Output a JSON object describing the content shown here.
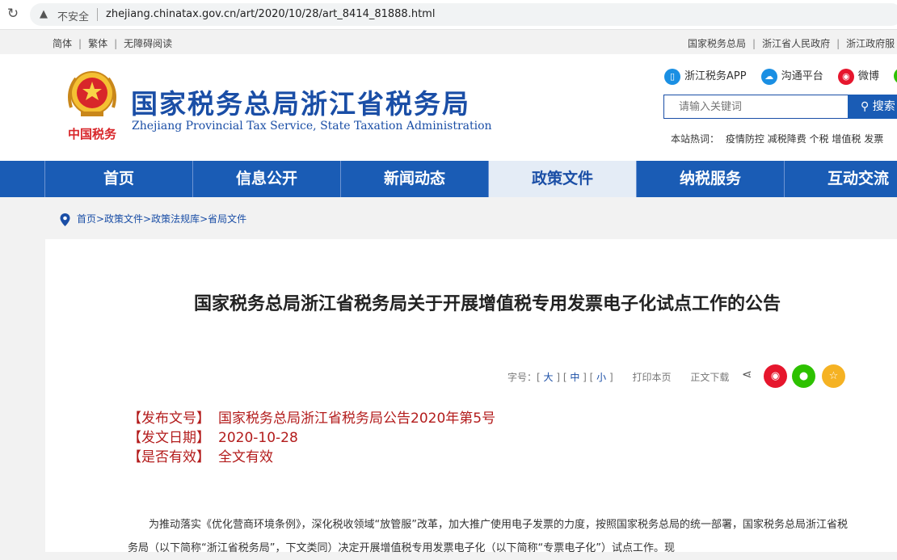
{
  "browser": {
    "security_label": "不安全",
    "url": "zhejiang.chinatax.gov.cn/art/2020/10/28/art_8414_81888.html"
  },
  "topbar": {
    "left": [
      "简体",
      "繁体",
      "无障碍阅读"
    ],
    "right": [
      "国家税务总局",
      "浙江省人民政府",
      "浙江政府服"
    ]
  },
  "header": {
    "logo_text": "中国税务",
    "title": "国家税务总局浙江省税务局",
    "title_en": "Zhejiang Provincial Tax Service, State Taxation Administration",
    "social": [
      {
        "label": "浙江税务APP",
        "icon": "phone-icon",
        "color": "#1a8fe3"
      },
      {
        "label": "沟通平台",
        "icon": "cloud-icon",
        "color": "#1a8fe3"
      },
      {
        "label": "微博",
        "icon": "weibo-icon",
        "color": "#e6162d"
      },
      {
        "label": "",
        "icon": "wechat-icon",
        "color": "#2dc100"
      }
    ],
    "search_placeholder": "请输入关键词",
    "search_button": "搜索",
    "hot_label": "本站热词：",
    "hot_words": [
      "疫情防控",
      "减税降费",
      "个税",
      "增值税",
      "发票"
    ]
  },
  "nav": {
    "items": [
      "首页",
      "信息公开",
      "新闻动态",
      "政策文件",
      "纳税服务",
      "互动交流"
    ],
    "active_index": 3
  },
  "breadcrumb": "首页>政策文件>政策法规库>省局文件",
  "article": {
    "title": "国家税务总局浙江省税务局关于开展增值税专用发票电子化试点工作的公告",
    "font_size_label": "字号：",
    "font_sizes": [
      "大",
      "中",
      "小"
    ],
    "print_label": "打印本页",
    "download_label": "正文下载",
    "share_buttons": [
      {
        "icon": "weibo-icon",
        "color": "#e6162d"
      },
      {
        "icon": "wechat-icon",
        "color": "#2dc100"
      },
      {
        "icon": "star-icon",
        "color": "#f5b223"
      }
    ],
    "meta": [
      {
        "label": "【发布文号】",
        "value": "国家税务总局浙江省税务局公告2020年第5号"
      },
      {
        "label": "【发文日期】",
        "value": "2020-10-28"
      },
      {
        "label": "【是否有效】",
        "value": "全文有效"
      }
    ],
    "body": "为推动落实《优化营商环境条例》，深化税收领域“放管服”改革，加大推广使用电子发票的力度，按照国家税务总局的统一部署，国家税务总局浙江省税务局（以下简称“浙江省税务局”，下文类同）决定开展增值税专用发票电子化（以下简称“专票电子化”）试点工作。现"
  }
}
